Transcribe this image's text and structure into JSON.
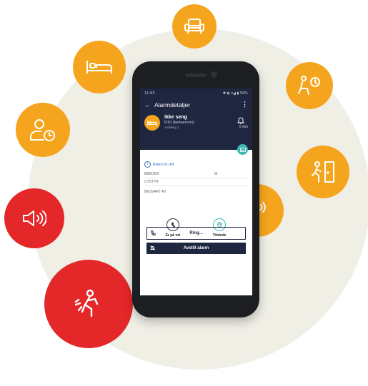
{
  "colors": {
    "orange": "#f5a51d",
    "red": "#e42728",
    "navy": "#1f2640",
    "teal": "#3fb7b0",
    "bg": "#f0efe6"
  },
  "status_bar": {
    "time": "11:03",
    "battery": "59%"
  },
  "app": {
    "title": "Alarmdetaljer",
    "back_icon": "arrow-left-icon",
    "menu_icon": "more-vert-icon"
  },
  "alarm": {
    "title": "Ikke seng",
    "room": "R10  (beboerrom)",
    "unit": "Avdeling 1",
    "time": "5 min",
    "icon": "bed-icon",
    "bell_icon": "bell-icon",
    "camera_icon": "camera-icon"
  },
  "details": {
    "risk_text": "Risiko for drit",
    "resident_label": "BEBOER",
    "resident_value": "M",
    "equipment_label": "UTSTYR",
    "answered_label": "BESVART AV"
  },
  "actions": {
    "on_way": "Er på vei",
    "present": "Tilstede",
    "ring": "Ring...",
    "cancel": "Avstill alarm"
  },
  "bubbles": [
    {
      "name": "armchair-icon",
      "color": "orange"
    },
    {
      "name": "bed-icon",
      "color": "orange"
    },
    {
      "name": "seated-timer-icon",
      "color": "orange"
    },
    {
      "name": "person-clock-icon",
      "color": "orange"
    },
    {
      "name": "exit-door-icon",
      "color": "orange"
    },
    {
      "name": "speaker-icon",
      "color": "red"
    },
    {
      "name": "walking-icon",
      "color": "orange"
    },
    {
      "name": "person-getting-up-icon",
      "color": "orange"
    },
    {
      "name": "fall-icon",
      "color": "red"
    }
  ]
}
